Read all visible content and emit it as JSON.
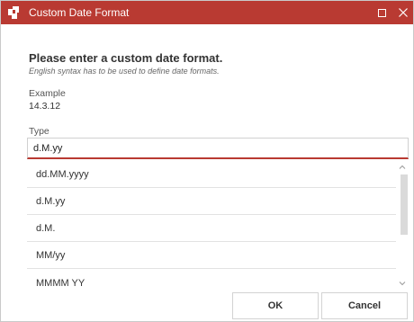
{
  "window": {
    "title": "Custom Date Format",
    "accent_color": "#b93a32",
    "icons": [
      "app-icon",
      "maximize-icon",
      "close-icon"
    ]
  },
  "dialog": {
    "heading": "Please enter a custom date format.",
    "subheading": "English syntax has to be used to define date formats.",
    "example_label": "Example",
    "example_value": "14.3.12",
    "type_label": "Type",
    "type_value": "d.M.yy"
  },
  "format_list": {
    "items": [
      "dd.MM.yyyy",
      "d.M.yy",
      "d.M.",
      "MM/yy",
      "MMMM YY"
    ]
  },
  "buttons": {
    "ok_label": "OK",
    "cancel_label": "Cancel"
  }
}
